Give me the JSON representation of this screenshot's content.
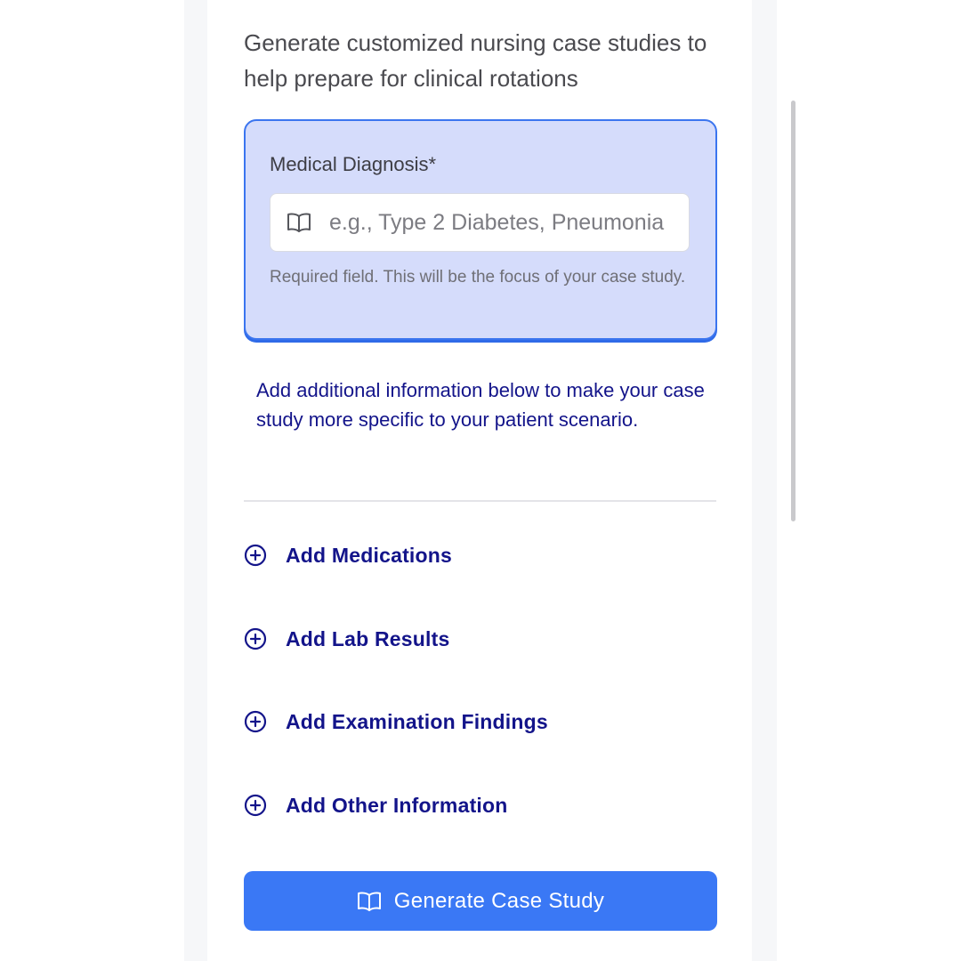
{
  "intro": {
    "subtitle": "Generate customized nursing case studies to help prepare for clinical rotations"
  },
  "diagnosis": {
    "label": "Medical Diagnosis*",
    "value": "",
    "placeholder": "e.g., Type 2 Diabetes, Pneumonia",
    "help_text": "Required field. This will be the focus of your case study.",
    "icon": "book-open-icon"
  },
  "info": {
    "text": "Add additional information below to make your case study more specific to your patient scenario."
  },
  "add_sections": {
    "icon": "plus-circle-icon",
    "items": [
      {
        "label": "Add Medications"
      },
      {
        "label": "Add Lab Results"
      },
      {
        "label": "Add Examination Findings"
      },
      {
        "label": "Add Other Information"
      }
    ]
  },
  "generate_button": {
    "label": "Generate Case Study",
    "icon": "book-open-icon"
  },
  "colors": {
    "accent": "#3a78f5",
    "diagnosis_bg": "#d5dcfb",
    "link_text": "#13148a"
  }
}
